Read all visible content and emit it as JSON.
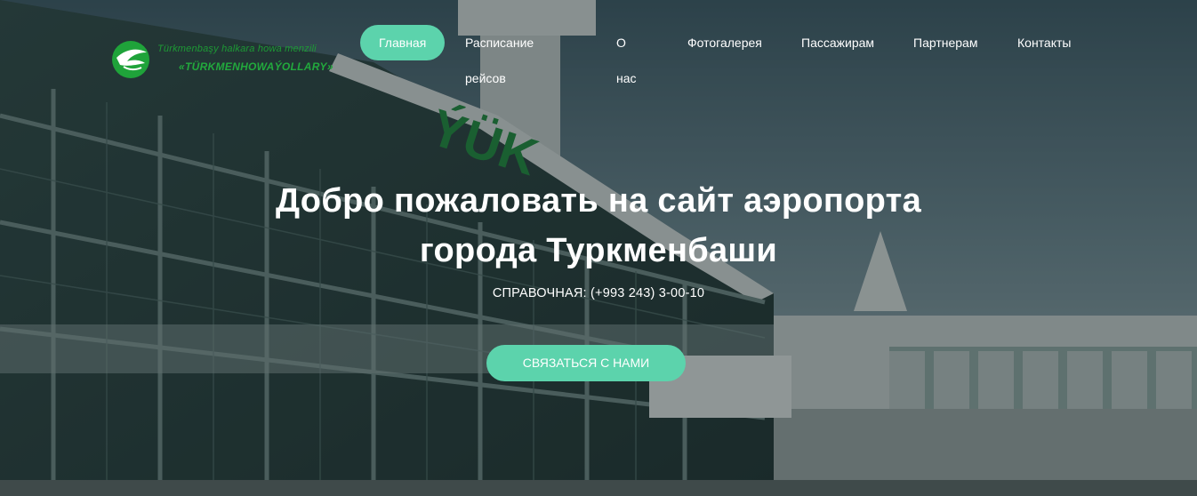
{
  "logo": {
    "line1": "Türkmenbaşy halkara howa menzili",
    "line2": "«TÜRKMENHOWAÝOLLARY»",
    "emblem_icon": "bird-emblem-icon",
    "color": "#1d9a35"
  },
  "nav": {
    "items": [
      {
        "label": "Главная",
        "active": true
      },
      {
        "label": "Расписание рейсов"
      },
      {
        "label": "О нас"
      },
      {
        "label": "Фотогалерея"
      },
      {
        "label": "Пассажирам"
      },
      {
        "label": "Партнерам"
      },
      {
        "label": "Контакты"
      }
    ],
    "active_color": "#5cd3ac"
  },
  "hero": {
    "title_line1": "Добро пожаловать на сайт аэропорта",
    "title_line2": "города Туркменбаши",
    "phone": "СПРАВОЧНАЯ: (+993 243) 3-00-10",
    "cta_label": "СВЯЗАТЬСЯ С НАМИ",
    "building_sign": "ÝÜK"
  },
  "colors": {
    "accent": "#5cd3ac",
    "sign_green": "#1f8a3d"
  }
}
